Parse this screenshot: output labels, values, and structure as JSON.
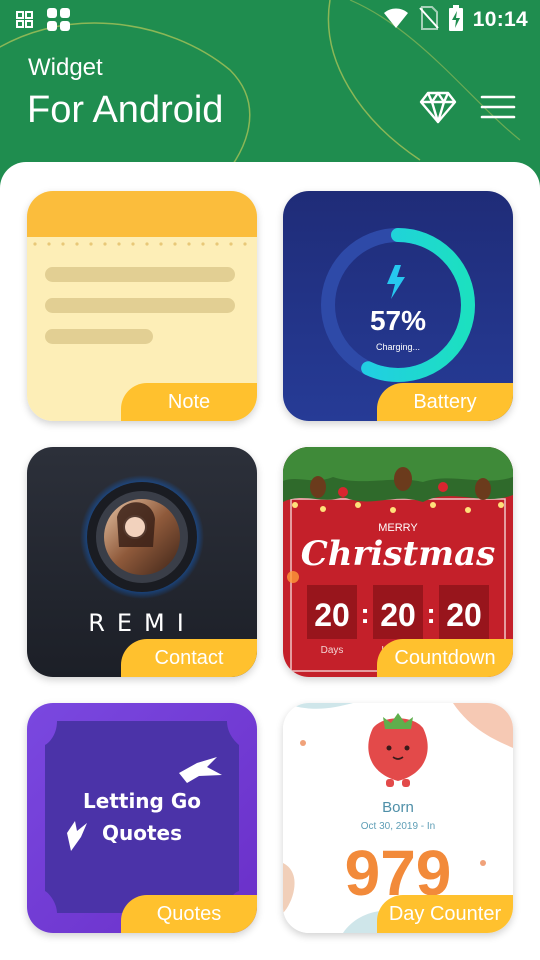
{
  "status_bar": {
    "time": "10:14",
    "icons": [
      "apps-small-icon",
      "apps-large-icon",
      "wifi-icon",
      "no-sim-icon",
      "battery-charging-icon"
    ]
  },
  "header": {
    "title_line1": "Widget",
    "title_line2": "For Android",
    "premium_icon": "diamond-icon",
    "menu_icon": "hamburger-menu-icon"
  },
  "colors": {
    "header_bg": "#1f8d4f",
    "label_bg": "#ffc12e",
    "sheet_bg": "#ffffff"
  },
  "widgets": [
    {
      "label": "Note"
    },
    {
      "label": "Battery",
      "preview": {
        "percent": "57%",
        "status": "Charging...",
        "level": 0.57
      }
    },
    {
      "label": "Contact",
      "preview": {
        "name": "REMI"
      }
    },
    {
      "label": "Countdown",
      "preview": {
        "line1": "MERRY",
        "line2": "Christmas",
        "days": "20",
        "hours": "20",
        "minutes": "20",
        "unit_days": "Days",
        "unit_hours": "H"
      }
    },
    {
      "label": "Quotes",
      "preview": {
        "line1": "Letting Go",
        "line2": "Quotes"
      }
    },
    {
      "label": "Day Counter",
      "preview": {
        "title": "Born",
        "date": "Oct 30, 2019 - In",
        "count": "979"
      }
    }
  ]
}
